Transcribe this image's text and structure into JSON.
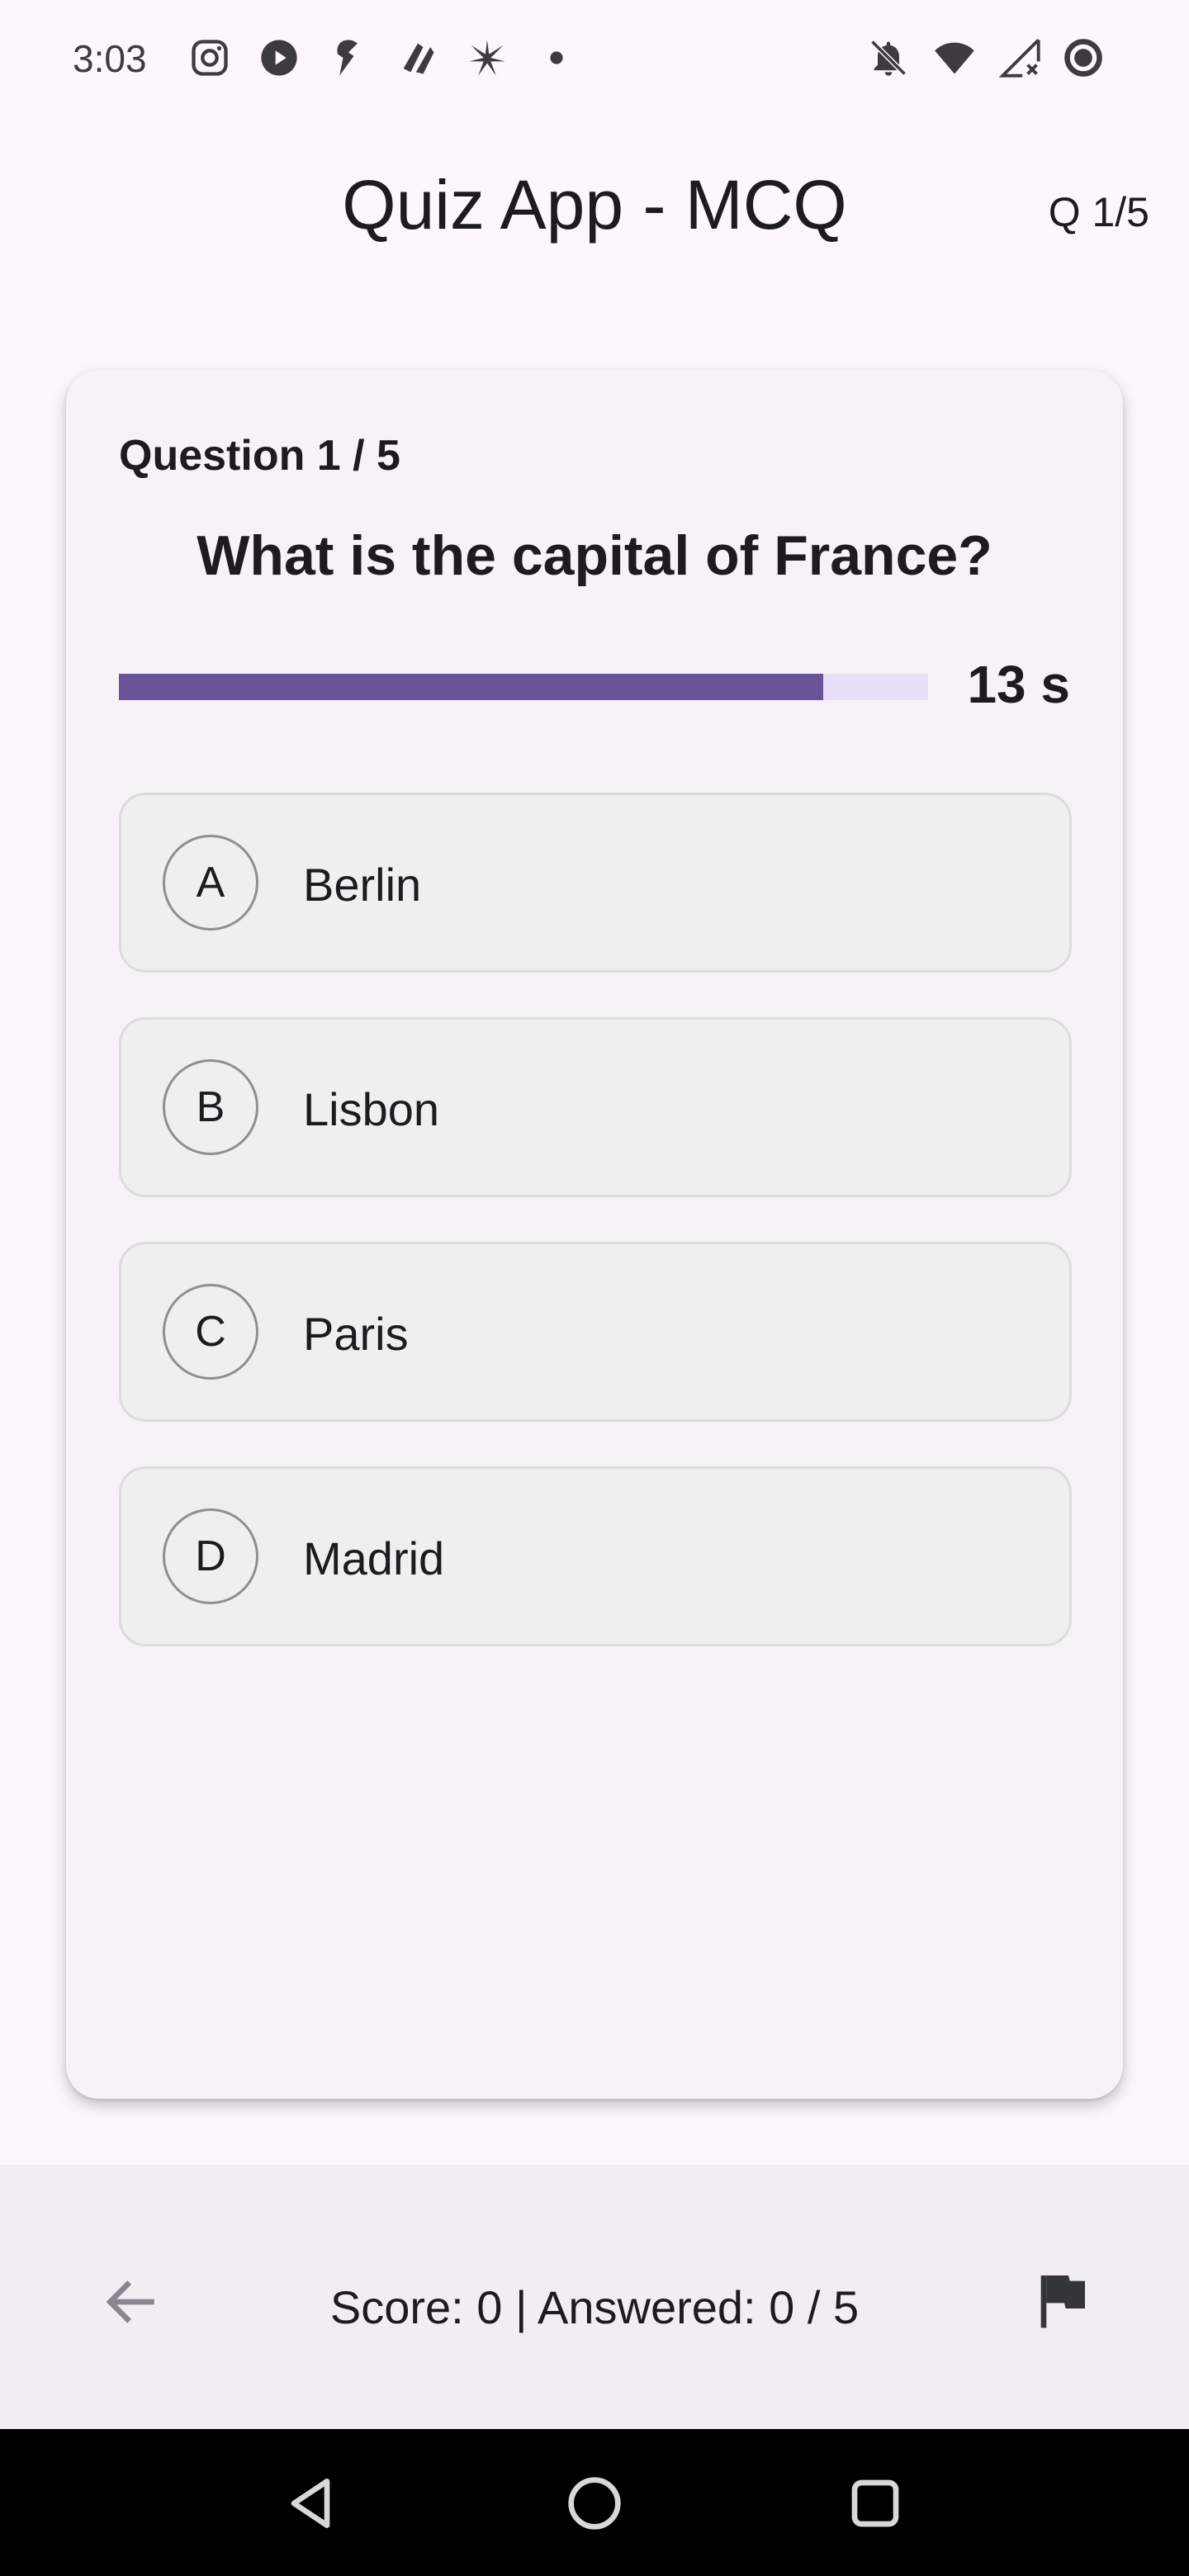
{
  "status_bar": {
    "time": "3:03",
    "left_icons": [
      "instagram-icon",
      "youtube-play-icon",
      "notification-app-icon",
      "app-icon",
      "sparkle-icon",
      "dot-icon"
    ],
    "right_icons": [
      "bell-muted-icon",
      "wifi-icon",
      "signal-no-service-icon",
      "battery-ring-icon"
    ]
  },
  "app_bar": {
    "title": "Quiz App - MCQ",
    "counter": "Q 1/5"
  },
  "question": {
    "label": "Question 1 / 5",
    "text": "What is the capital of France?",
    "timer_text": "13 s",
    "timer_fraction": 0.87
  },
  "options": [
    {
      "letter": "A",
      "text": "Berlin"
    },
    {
      "letter": "B",
      "text": "Lisbon"
    },
    {
      "letter": "C",
      "text": "Paris"
    },
    {
      "letter": "D",
      "text": "Madrid"
    }
  ],
  "bottom_bar": {
    "score_text": "Score: 0 | Answered: 0 / 5",
    "back_icon": "arrow-back-icon",
    "flag_icon": "flag-icon"
  },
  "nav_bar": {
    "icons": [
      "nav-back-icon",
      "nav-home-icon",
      "nav-recents-icon"
    ]
  },
  "colors": {
    "accent": "#6a5397",
    "track": "#e8def8",
    "background": "#fdf7fc",
    "card": "#f7f2f8"
  }
}
